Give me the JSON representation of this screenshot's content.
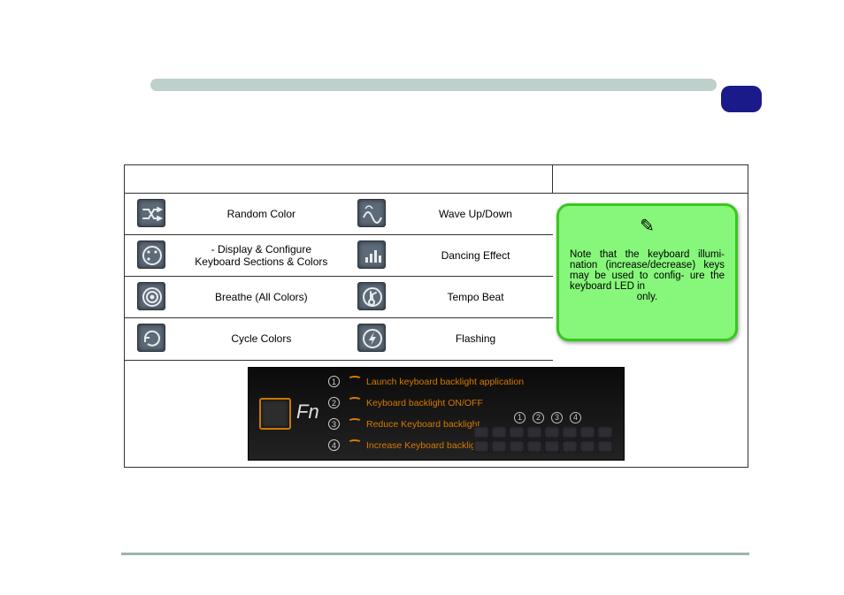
{
  "icons": {
    "random": "random-icon",
    "custom": "palette-icon",
    "breathe": "concentric-icon",
    "cycle": "cycle-icon",
    "wave": "wave-icon",
    "dancing": "dancing-icon",
    "tempo": "tempo-icon",
    "flashing": "flash-icon",
    "pencil": "✎"
  },
  "labels": {
    "random": "Random Color",
    "custom_prefix": " - Display & Configure",
    "custom_line2": "Keyboard Sections & Colors",
    "breathe": "Breathe (All Colors)",
    "cycle": "Cycle Colors",
    "wave": "Wave Up/Down",
    "dancing": "Dancing Effect",
    "tempo": "Tempo Beat",
    "flashing": "Flashing"
  },
  "note": {
    "line1": "Note that the keyboard illumi-",
    "line2": "nation (increase/decrease)",
    "line3": "keys may be used to config-",
    "line4": "ure the keyboard LED in",
    "line5": "only."
  },
  "fn": {
    "label": "Fn",
    "lines": [
      {
        "n": "1",
        "text": "Launch keyboard backlight application"
      },
      {
        "n": "2",
        "text": "Keyboard backlight ON/OFF"
      },
      {
        "n": "3",
        "text": "Reduce Keyboard backlight"
      },
      {
        "n": "4",
        "text": "Increase Keyboard backlight"
      }
    ],
    "nums": [
      "①",
      "②",
      "③",
      "④"
    ]
  }
}
